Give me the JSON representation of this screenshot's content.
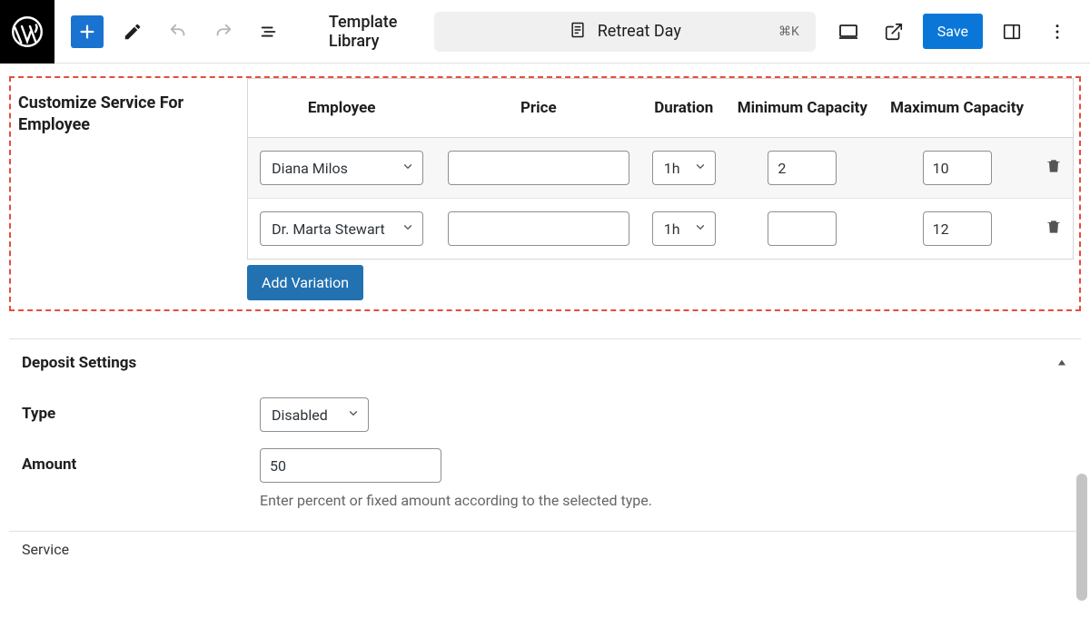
{
  "topbar": {
    "template_library": "Template Library",
    "doc_title": "Retreat Day",
    "shortcut": "⌘K",
    "save": "Save"
  },
  "customize": {
    "section_title": "Customize Service For Employee",
    "headers": {
      "employee": "Employee",
      "price": "Price",
      "duration": "Duration",
      "min_cap": "Minimum Capacity",
      "max_cap": "Maximum Capacity"
    },
    "rows": [
      {
        "employee": "Diana Milos",
        "price": "",
        "duration": "1h",
        "min": "2",
        "max": "10"
      },
      {
        "employee": "Dr. Marta Stewart",
        "price": "",
        "duration": "1h",
        "min": "",
        "max": "12"
      }
    ],
    "add_variation": "Add Variation"
  },
  "deposit": {
    "title": "Deposit Settings",
    "type_label": "Type",
    "type_value": "Disabled",
    "amount_label": "Amount",
    "amount_value": "50",
    "amount_help": "Enter percent or fixed amount according to the selected type."
  },
  "service": {
    "label": "Service"
  }
}
